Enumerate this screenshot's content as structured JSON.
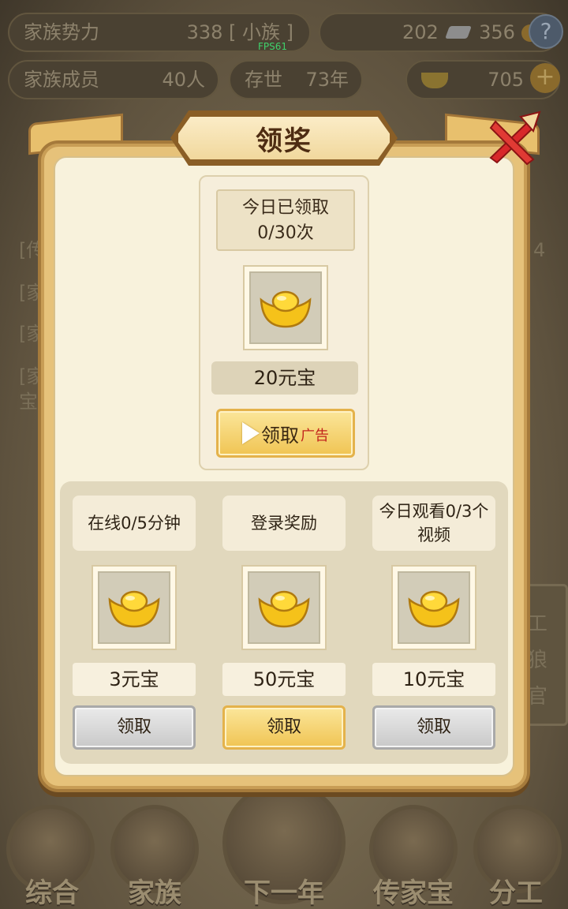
{
  "background": {
    "stats": {
      "clan_power_label": "家族势力",
      "clan_power_value": "338",
      "clan_power_rank": "[ 小族 ]",
      "resource_a": "202",
      "resource_b": "356",
      "members_label": "家族成员",
      "members_value": "40人",
      "living_label": "存世",
      "living_value": "73年",
      "gold_value": "705",
      "fps": "FPS61"
    },
    "side_left_texts": [
      "[传",
      "[家",
      "[家",
      "[家",
      "宝"
    ],
    "side_right_text": "4",
    "sign_text": [
      "工",
      "狼",
      "官"
    ],
    "nav": [
      "综合",
      "家族",
      "下一年",
      "传家宝",
      "分工"
    ]
  },
  "modal": {
    "title": "领奖",
    "ad_reward": {
      "count_line1": "今日已领取",
      "count_line2": "0/30次",
      "item": "gold-ingot",
      "amount": "20元宝",
      "button_label": "领取",
      "button_tag": "广告"
    },
    "rewards": [
      {
        "condition": "在线0/5分钟",
        "item": "gold-ingot",
        "amount": "3元宝",
        "button": "领取",
        "state": "disabled"
      },
      {
        "condition": "登录奖励",
        "item": "gold-ingot",
        "amount": "50元宝",
        "button": "领取",
        "state": "active"
      },
      {
        "condition": "今日观看0/3个视频",
        "item": "gold-ingot",
        "amount": "10元宝",
        "button": "领取",
        "state": "disabled"
      }
    ]
  },
  "colors": {
    "accent_gold": "#f0c453",
    "close_red": "#d8282a",
    "ingot_gold": "#f5c21a"
  }
}
